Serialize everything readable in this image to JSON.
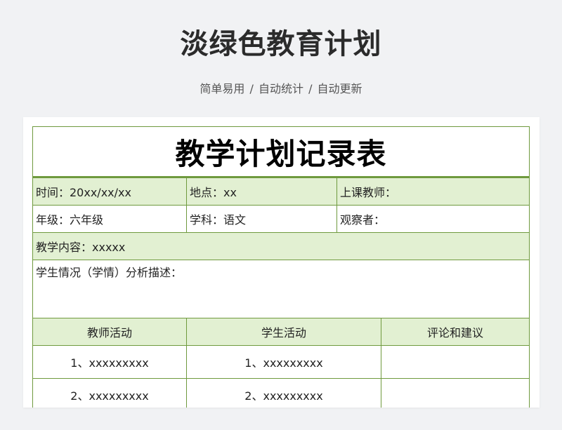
{
  "header": {
    "title": "淡绿色教育计划",
    "subtitle": "简单易用 / 自动统计 / 自动更新"
  },
  "sheet": {
    "title": "教学计划记录表",
    "time": "时间：20xx/xx/xx",
    "location": "地点：xx",
    "teacher": "上课教师：",
    "grade": "年级：六年级",
    "subject": "学科：语文",
    "observer": "观察者：",
    "content": "教学内容：xxxxx",
    "analysis": "学生情况（学情）分析描述：",
    "columns": [
      "教师活动",
      "学生活动",
      "评论和建议"
    ],
    "rows": [
      {
        "teacher": "1、xxxxxxxxx",
        "student": "1、xxxxxxxxx",
        "comment": ""
      },
      {
        "teacher": "2、xxxxxxxxx",
        "student": "2、xxxxxxxxx",
        "comment": ""
      }
    ]
  },
  "colors": {
    "border": "#6f9a3e",
    "fill": "#e2f0d2",
    "page_bg": "#f1f2f4"
  }
}
